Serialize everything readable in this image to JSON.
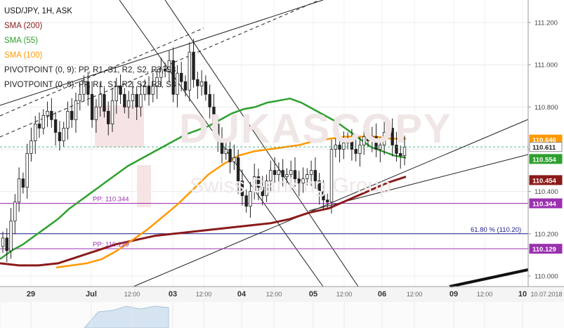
{
  "legend": {
    "title": "USD/JPY, 1H, ASK",
    "sma200": "SMA (200)",
    "sma55": "SMA (55)",
    "sma100": "SMA (100)",
    "pivot1": "PIVOTPOINT (0, 9): PP, R1, S1, R2, S2, R3, S3",
    "pivot2": "PIVOTPOINT (0, 8): PP, R1, S1, R2, S2, R3, S3"
  },
  "watermark": {
    "brand": "DUKASCOPY",
    "sub": "Swiss Banking Group"
  },
  "colors": {
    "sma200": "#8b1a1a",
    "sma55": "#2ea02e",
    "sma100": "#ff9900",
    "pivot": "#9b30b0",
    "fib": "#1c1c8c",
    "candle": "#222222"
  },
  "chart_data": {
    "type": "candlestick",
    "title": "USD/JPY, 1H, ASK",
    "ylim": [
      109.95,
      111.28
    ],
    "y_ticks": [
      "111.200",
      "111.000",
      "110.800",
      "110.600",
      "110.400",
      "110.200",
      "110.000"
    ],
    "x_ticks": [
      "29",
      "Jul",
      "12:00",
      "03",
      "12:00",
      "04",
      "12:00",
      "05",
      "12:00",
      "06",
      "12:00",
      "09",
      "12:00",
      "10",
      "10.07.2018"
    ],
    "price_tags": [
      {
        "label": "110.646",
        "value": 110.646,
        "color": "#ff9900"
      },
      {
        "label": "110.611",
        "value": 110.611,
        "color": "#ffffff"
      },
      {
        "label": "110.554",
        "value": 110.554,
        "color": "#2ea02e"
      },
      {
        "label": "110.454",
        "value": 110.454,
        "color": "#8b1a1a"
      },
      {
        "label": "110.344",
        "value": 110.344,
        "color": "#9b30b0"
      },
      {
        "label": "110.129",
        "value": 110.129,
        "color": "#9b30b0"
      }
    ],
    "horizontal_lines": [
      {
        "label": "PP: 110.344",
        "value": 110.344
      },
      {
        "label": "61.80 % (110.20)",
        "value": 110.2
      },
      {
        "label": "PP: 110.129",
        "value": 110.129
      }
    ],
    "candles_close": [
      110.18,
      110.12,
      110.26,
      110.35,
      110.46,
      110.42,
      110.58,
      110.64,
      110.72,
      110.7,
      110.76,
      110.78,
      110.74,
      110.68,
      110.64,
      110.7,
      110.78,
      110.74,
      110.83,
      110.86,
      110.92,
      110.86,
      110.74,
      110.8,
      110.86,
      110.78,
      110.72,
      110.83,
      110.9,
      110.86,
      110.8,
      110.83,
      110.86,
      110.8,
      110.86,
      110.9,
      110.86,
      110.9,
      110.94,
      110.98,
      110.97,
      111.02,
      110.86,
      110.96,
      110.92,
      110.88,
      111.06,
      110.93,
      110.9,
      110.92,
      110.86,
      110.8,
      110.72,
      110.65,
      110.58,
      110.6,
      110.54,
      110.56,
      110.45,
      110.38,
      110.33,
      110.4,
      110.47,
      110.42,
      110.38,
      110.45,
      110.5,
      110.48,
      110.5,
      110.47,
      110.48,
      110.5,
      110.46,
      110.44,
      110.46,
      110.48,
      110.5,
      110.45,
      110.4,
      110.36,
      110.35,
      110.6,
      110.62,
      110.6,
      110.63,
      110.65,
      110.6,
      110.58,
      110.62,
      110.66,
      110.64,
      110.66,
      110.6,
      110.62,
      110.68,
      110.7,
      110.62,
      110.58,
      110.57,
      110.61
    ],
    "sma55": [
      110.08,
      110.12,
      110.15,
      110.19,
      110.23,
      110.27,
      110.32,
      110.36,
      110.4,
      110.44,
      110.48,
      110.52,
      110.55,
      110.58,
      110.61,
      110.64,
      110.67,
      110.69,
      110.71,
      110.74,
      110.77,
      110.79,
      110.8,
      110.82,
      110.83,
      110.84,
      110.82,
      110.79,
      110.76,
      110.73,
      110.69,
      110.65,
      110.61,
      110.59,
      110.57,
      110.56
    ],
    "sma100": [
      110.04,
      110.05,
      110.06,
      110.08,
      110.12,
      110.17,
      110.22,
      110.28,
      110.34,
      110.41,
      110.48,
      110.53,
      110.57,
      110.59,
      110.6,
      110.61,
      110.62,
      110.64,
      110.65,
      110.66,
      110.66,
      110.66,
      110.65,
      110.65
    ],
    "sma200": [
      110.06,
      110.05,
      110.05,
      110.06,
      110.09,
      110.12,
      110.15,
      110.17,
      110.19,
      110.2,
      110.21,
      110.22,
      110.23,
      110.24,
      110.25,
      110.27,
      110.3,
      110.32,
      110.36,
      110.4,
      110.44,
      110.47
    ],
    "x_labels_present": [
      "29",
      "Jul",
      "03",
      "04",
      "05",
      "06",
      "09",
      "10"
    ]
  }
}
